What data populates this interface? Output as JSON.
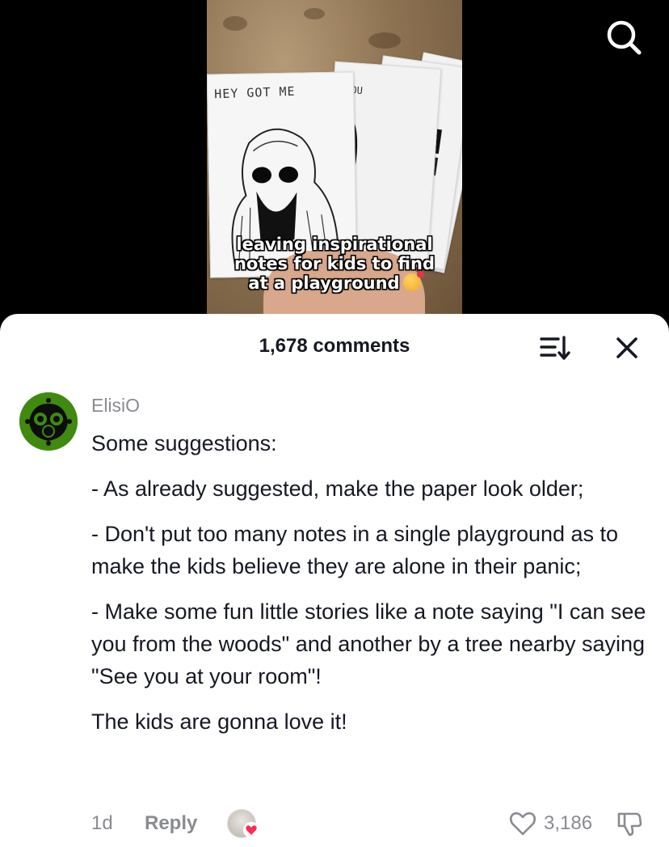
{
  "video": {
    "card_text": "HEY GOT ME",
    "card_text_2": "YOU",
    "caption_lines": [
      "leaving inspirational",
      "notes for kids to find",
      "at a playground"
    ],
    "caption_emoji": "smiling-face-with-hearts"
  },
  "icons": {
    "search": "search-icon",
    "sort": "sort-icon",
    "close": "close-icon",
    "heart": "heart-outline-icon",
    "dislike": "thumbs-down-icon"
  },
  "comments_sheet": {
    "count_label": "1,678 comments",
    "comment": {
      "username": "ElisiO",
      "paragraphs": [
        "Some suggestions:",
        "- As already suggested, make the paper look older;",
        "- Don't put too many notes in a single playground as to make the kids believe they are alone in their panic;",
        "- Make some fun little stories like a note saying \"I can see you from the woods\" and another by a tree nearby saying \"See you at your room\"!",
        "The kids are gonna love it!"
      ],
      "time": "1d",
      "reply_label": "Reply",
      "like_count": "3,186"
    }
  },
  "colors": {
    "avatar_green": "#3f8a0f",
    "muted_text": "#8a8b91",
    "liked_heart": "#fe2c55"
  }
}
